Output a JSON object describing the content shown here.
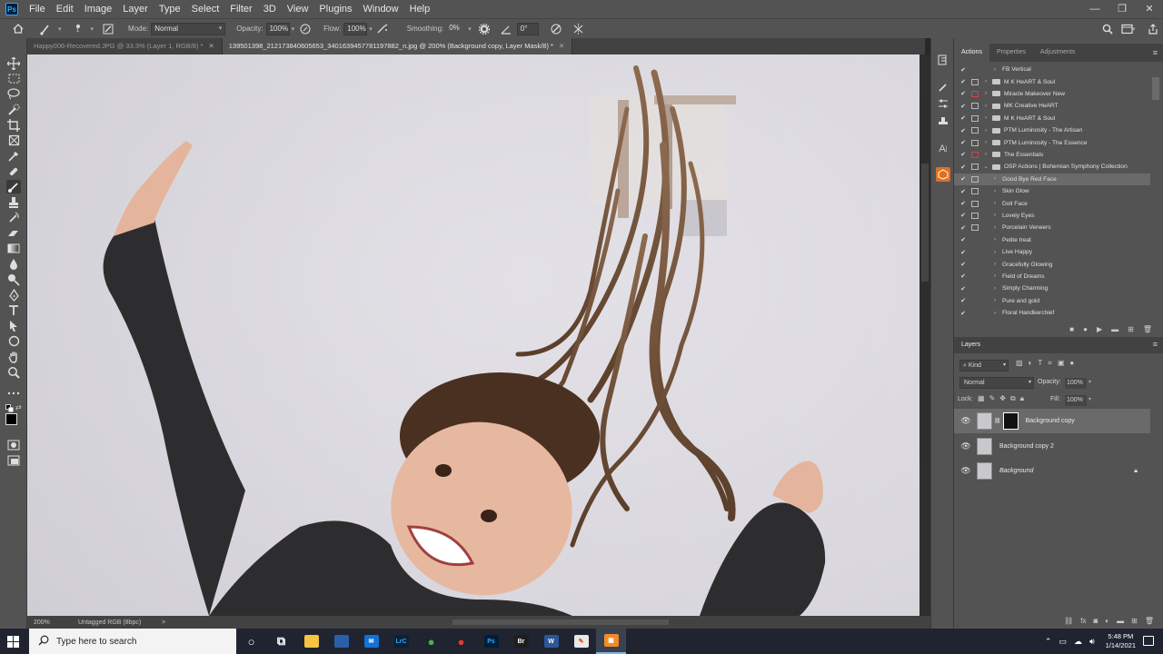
{
  "menubar": {
    "logo": "Ps",
    "items": [
      "File",
      "Edit",
      "Image",
      "Layer",
      "Type",
      "Select",
      "Filter",
      "3D",
      "View",
      "Plugins",
      "Window",
      "Help"
    ],
    "window_controls": [
      "—",
      "❐",
      "✕"
    ]
  },
  "options": {
    "mode_label": "Mode:",
    "mode_value": "Normal",
    "opacity_label": "Opacity:",
    "opacity_value": "100%",
    "flow_label": "Flow:",
    "flow_value": "100%",
    "smoothing_label": "Smoothing:",
    "smoothing_value": "0%",
    "angle_value": "0°",
    "brush_size": "1"
  },
  "tabs": [
    {
      "label": "Happy006-Recovered.JPG @ 33.3% (Layer 1, RGB/8) *",
      "active": false
    },
    {
      "label": "139501398_212173840605653_3401639457781197882_n.jpg @ 200% (Background copy, Layer Mask/8) *",
      "active": true
    }
  ],
  "status": {
    "zoom": "200%",
    "doc_info": "Untagged RGB (8bpc)",
    "arrow": ">"
  },
  "actions_panel": {
    "tabs": [
      "Actions",
      "Properties",
      "Adjustments"
    ],
    "rows": [
      {
        "label": "FB Vertical",
        "check": "✔",
        "dialog": false,
        "red": false,
        "folder": false,
        "twist": "›",
        "indent": 1,
        "highlight": false
      },
      {
        "label": "M K HeART & Soul",
        "check": "✔",
        "dialog": true,
        "red": false,
        "folder": true,
        "twist": "›",
        "indent": 0,
        "highlight": false
      },
      {
        "label": "Miracle Makeover New",
        "check": "✔",
        "dialog": true,
        "red": true,
        "folder": true,
        "twist": "›",
        "indent": 0,
        "highlight": false
      },
      {
        "label": "MK Creative HeART",
        "check": "✔",
        "dialog": true,
        "red": false,
        "folder": true,
        "twist": "›",
        "indent": 0,
        "highlight": false
      },
      {
        "label": "M K HeART & Soul",
        "check": "✔",
        "dialog": true,
        "red": false,
        "folder": true,
        "twist": "›",
        "indent": 0,
        "highlight": false
      },
      {
        "label": "PTM Luminosity - The Artisan",
        "check": "✔",
        "dialog": true,
        "red": false,
        "folder": true,
        "twist": "›",
        "indent": 0,
        "highlight": false
      },
      {
        "label": "PTM Luminosity - The Essence",
        "check": "✔",
        "dialog": true,
        "red": false,
        "folder": true,
        "twist": "›",
        "indent": 0,
        "highlight": false
      },
      {
        "label": "The Essentials",
        "check": "✔",
        "dialog": true,
        "red": true,
        "folder": true,
        "twist": "›",
        "indent": 0,
        "highlight": false
      },
      {
        "label": "OSP Actions | Bohemian Symphony Collection",
        "check": "✔",
        "dialog": true,
        "red": false,
        "folder": true,
        "twist": "⌄",
        "indent": 0,
        "highlight": false
      },
      {
        "label": "Good Bye Red Face",
        "check": "✔",
        "dialog": true,
        "red": false,
        "folder": false,
        "twist": "›",
        "indent": 1,
        "highlight": true
      },
      {
        "label": "Skin Glow",
        "check": "✔",
        "dialog": true,
        "red": false,
        "folder": false,
        "twist": "›",
        "indent": 1,
        "highlight": false
      },
      {
        "label": "Doll Face",
        "check": "✔",
        "dialog": true,
        "red": false,
        "folder": false,
        "twist": "›",
        "indent": 1,
        "highlight": false
      },
      {
        "label": "Lovely Eyes",
        "check": "✔",
        "dialog": true,
        "red": false,
        "folder": false,
        "twist": "›",
        "indent": 1,
        "highlight": false
      },
      {
        "label": "Porcelain Veneers",
        "check": "✔",
        "dialog": true,
        "red": false,
        "folder": false,
        "twist": "›",
        "indent": 1,
        "highlight": false
      },
      {
        "label": "Petite treat",
        "check": "✔",
        "dialog": false,
        "red": false,
        "folder": false,
        "twist": "›",
        "indent": 1,
        "highlight": false
      },
      {
        "label": "Live Happy",
        "check": "✔",
        "dialog": false,
        "red": false,
        "folder": false,
        "twist": "›",
        "indent": 1,
        "highlight": false
      },
      {
        "label": "Gracefully Glowing",
        "check": "✔",
        "dialog": false,
        "red": false,
        "folder": false,
        "twist": "›",
        "indent": 1,
        "highlight": false
      },
      {
        "label": "Field of Dreams",
        "check": "✔",
        "dialog": false,
        "red": false,
        "folder": false,
        "twist": "›",
        "indent": 1,
        "highlight": false
      },
      {
        "label": "Simply Charming",
        "check": "✔",
        "dialog": false,
        "red": false,
        "folder": false,
        "twist": "›",
        "indent": 1,
        "highlight": false
      },
      {
        "label": "Pure and gold",
        "check": "✔",
        "dialog": false,
        "red": false,
        "folder": false,
        "twist": "›",
        "indent": 1,
        "highlight": false
      },
      {
        "label": "Floral Handkerchief",
        "check": "✔",
        "dialog": false,
        "red": false,
        "folder": false,
        "twist": "›",
        "indent": 1,
        "highlight": false
      }
    ]
  },
  "layers_panel": {
    "title": "Layers",
    "filter": "Kind",
    "blend_mode": "Normal",
    "opacity_label": "Opacity:",
    "opacity_value": "100%",
    "lock_label": "Lock:",
    "fill_label": "Fill:",
    "fill_value": "100%",
    "layers": [
      {
        "name": "Background copy",
        "selected": true,
        "has_mask": true,
        "italic": false,
        "locked": false
      },
      {
        "name": "Background copy 2",
        "selected": false,
        "has_mask": false,
        "italic": false,
        "locked": false
      },
      {
        "name": "Background",
        "selected": false,
        "has_mask": false,
        "italic": true,
        "locked": true
      }
    ]
  },
  "taskbar": {
    "search_placeholder": "Type here to search",
    "time": "5:48 PM",
    "date": "1/14/2021",
    "apps": [
      {
        "name": "cortana",
        "glyph": "○",
        "bg": "transparent",
        "fg": "#ffffff"
      },
      {
        "name": "task-view",
        "glyph": "⧉",
        "bg": "transparent",
        "fg": "#ffffff"
      },
      {
        "name": "file-explorer",
        "glyph": "",
        "bg": "#f6c343",
        "fg": "#1f2430"
      },
      {
        "name": "store",
        "glyph": "",
        "bg": "#2b5ea8",
        "fg": "#ffffff"
      },
      {
        "name": "mail",
        "glyph": "✉",
        "bg": "#1570d8",
        "fg": "#ffffff"
      },
      {
        "name": "lightroom-classic",
        "glyph": "LrC",
        "bg": "#0b2134",
        "fg": "#31a8ff"
      },
      {
        "name": "chrome",
        "glyph": "●",
        "bg": "transparent",
        "fg": "#4caf50"
      },
      {
        "name": "chrome-alt",
        "glyph": "●",
        "bg": "transparent",
        "fg": "#e53935"
      },
      {
        "name": "photoshop",
        "glyph": "Ps",
        "bg": "#001e36",
        "fg": "#31a8ff"
      },
      {
        "name": "bridge",
        "glyph": "Br",
        "bg": "#1e1e1e",
        "fg": "#ffffff"
      },
      {
        "name": "word",
        "glyph": "W",
        "bg": "#2b579a",
        "fg": "#ffffff"
      },
      {
        "name": "paint",
        "glyph": "✎",
        "bg": "#e8e8e8",
        "fg": "#e65100"
      },
      {
        "name": "orange-app",
        "glyph": "▣",
        "bg": "#f08c28",
        "fg": "#ffffff"
      }
    ]
  }
}
